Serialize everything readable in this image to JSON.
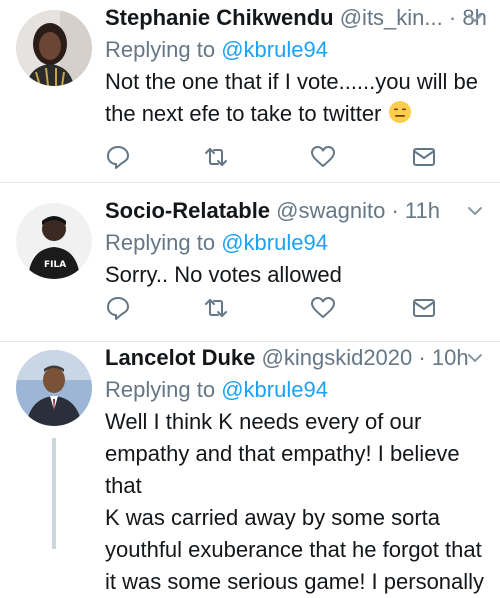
{
  "tweets": [
    {
      "name": "Stephanie Chikwendu",
      "handle": "@its_kin...",
      "separator": "·",
      "time": "8h",
      "replying_prefix": "Replying to",
      "replying_to": "@kbrule94",
      "lines": [
        "Not the one that if I vote......you will be",
        "the next efe to take to twitter"
      ],
      "emoji": "expressionless-face-emoji"
    },
    {
      "name": "Socio-Relatable",
      "handle": "@swagnito",
      "separator": "·",
      "time": "11h",
      "replying_prefix": "Replying to",
      "replying_to": "@kbrule94",
      "lines": [
        "Sorry.. No votes allowed"
      ]
    },
    {
      "name": "Lancelot Duke",
      "handle": "@kingskid2020",
      "separator": "·",
      "time": "10h",
      "replying_prefix": "Replying to",
      "replying_to": "@kbrule94",
      "lines": [
        "Well I think K needs every of our",
        "empathy and that empathy! I believe that",
        "K was carried away by some sorta",
        "youthful exuberance that he forgot that",
        "it was some serious game! I personally"
      ]
    }
  ],
  "icons": {
    "reply": "reply-icon",
    "retweet": "retweet-icon",
    "like": "heart-icon",
    "dm": "mail-icon",
    "caret": "chevron-down-icon"
  },
  "colors": {
    "secondary_text": "#657786",
    "mention": "#1da1f2",
    "divider": "#e1e8ed",
    "thread_line": "#ccd6dd"
  }
}
